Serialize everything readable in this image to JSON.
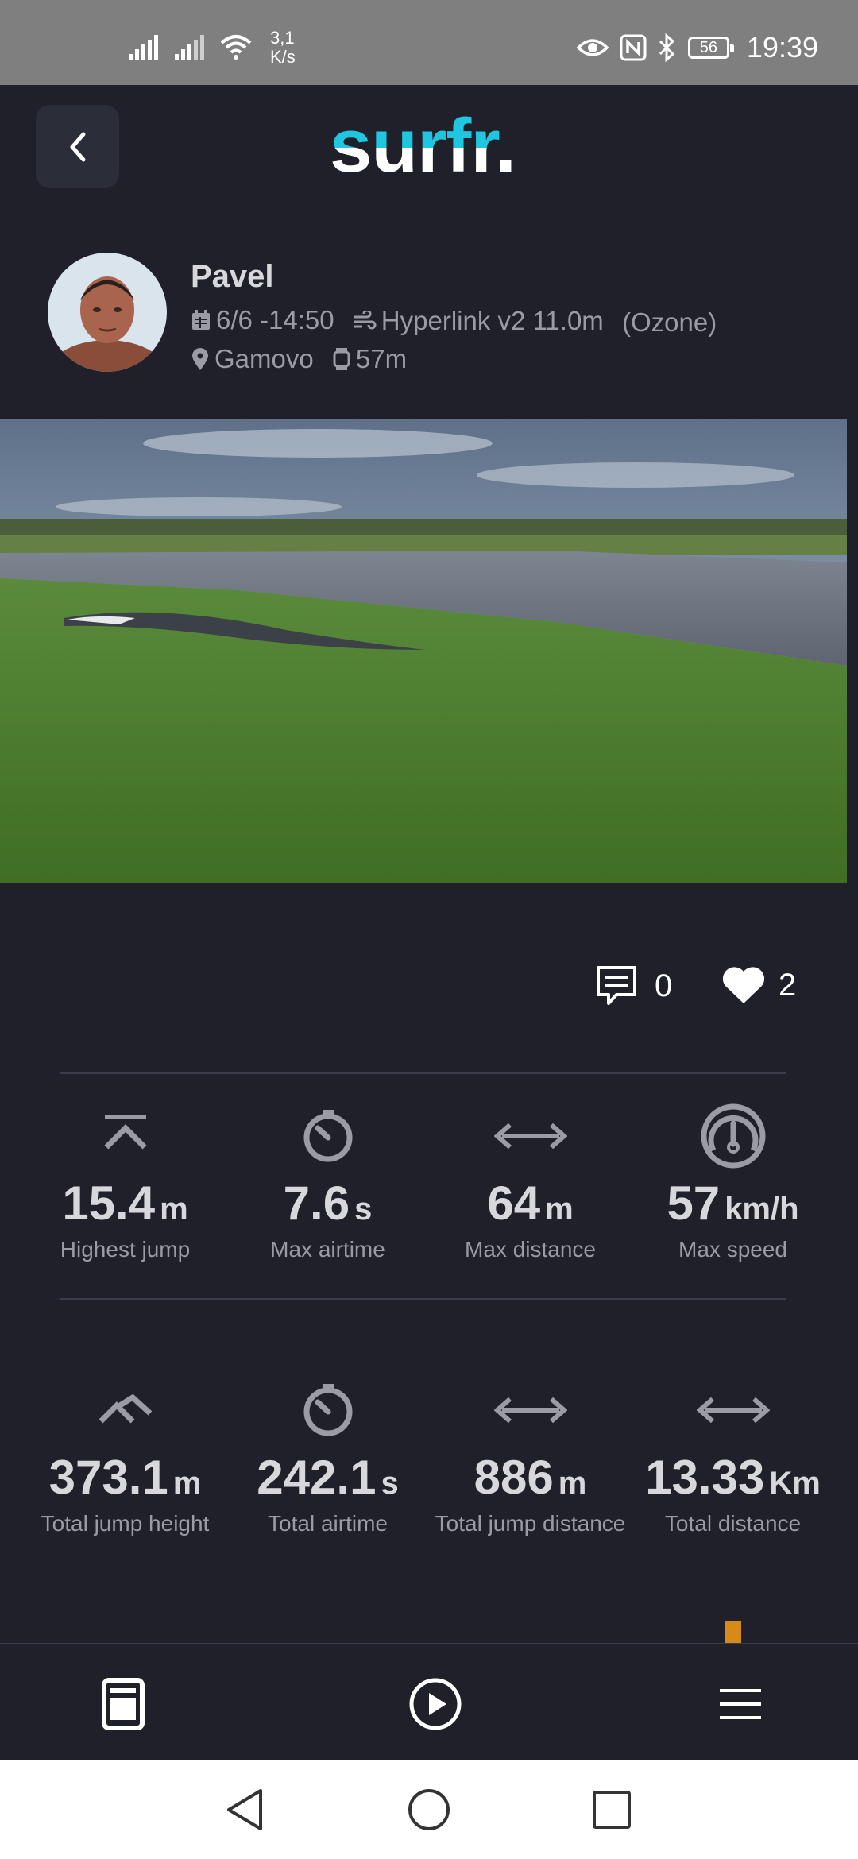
{
  "status_bar": {
    "net_speed_value": "3,1",
    "net_speed_unit": "K/s",
    "battery": "56",
    "time": "19:39"
  },
  "header": {
    "logo": "surfr."
  },
  "session": {
    "user_name": "Pavel",
    "date": "6/6 -14:50",
    "equipment": "Hyperlink v2 11.0m",
    "brand": "(Ozone)",
    "location": "Gamovo",
    "session_stat": "57m"
  },
  "social": {
    "comments_count": "0",
    "likes_count": "2"
  },
  "stats_top": [
    {
      "value": "15.4",
      "unit": "m",
      "label": "Highest jump",
      "icon": "jump-up-icon"
    },
    {
      "value": "7.6",
      "unit": "s",
      "label": "Max airtime",
      "icon": "timer-icon"
    },
    {
      "value": "64",
      "unit": "m",
      "label": "Max distance",
      "icon": "arrows-horizontal-icon"
    },
    {
      "value": "57",
      "unit": "km/h",
      "label": "Max speed",
      "icon": "speedometer-icon"
    }
  ],
  "stats_bottom": [
    {
      "value": "373.1",
      "unit": "m",
      "label": "Total jump height",
      "icon": "double-chevron-up-icon"
    },
    {
      "value": "242.1",
      "unit": "s",
      "label": "Total airtime",
      "icon": "timer-icon"
    },
    {
      "value": "886",
      "unit": "m",
      "label": "Total jump distance",
      "icon": "arrows-horizontal-icon"
    },
    {
      "value": "13.33",
      "unit": "Km",
      "label": "Total distance",
      "icon": "arrows-horizontal-icon"
    }
  ],
  "colors": {
    "background": "#1f2029",
    "accent_logo": "#1fc6e0",
    "scroll_marker": "#d68a19"
  }
}
